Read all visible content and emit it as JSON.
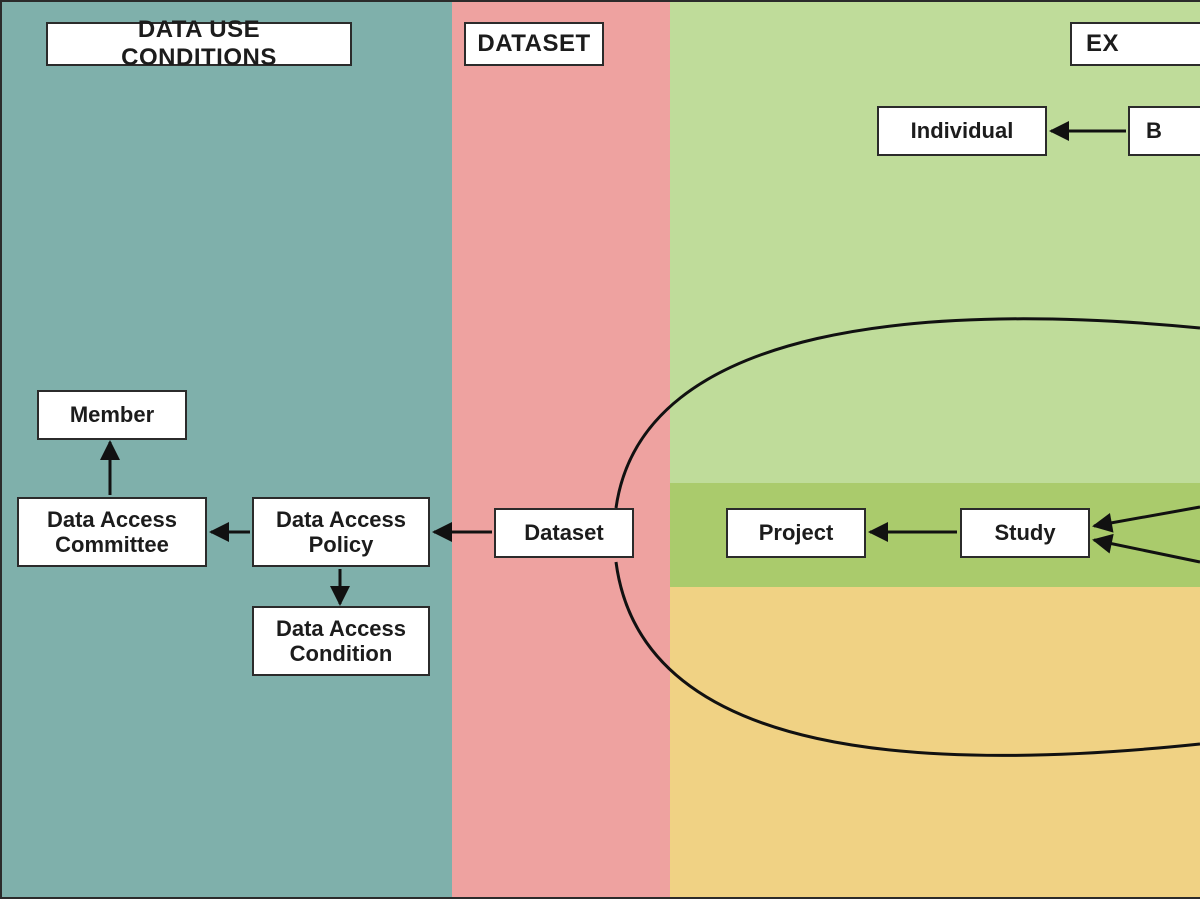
{
  "diagram": {
    "regions": {
      "data_use_conditions": {
        "label": "DATA USE CONDITIONS",
        "color": "#7fb0ab"
      },
      "dataset": {
        "label": "DATASET",
        "color": "#eea2a0"
      },
      "experiment_partial": {
        "label": "EX",
        "color_top": "#bfdc9a",
        "color_bottom": "#f0d284",
        "band": "#aacb6c"
      }
    },
    "nodes": {
      "member": {
        "label": "Member"
      },
      "data_access_committee": {
        "label": "Data Access Committee"
      },
      "data_access_policy": {
        "label": "Data Access Policy"
      },
      "data_access_condition": {
        "label": "Data Access Condition"
      },
      "dataset": {
        "label": "Dataset"
      },
      "project": {
        "label": "Project"
      },
      "study": {
        "label": "Study"
      },
      "individual": {
        "label": "Individual"
      },
      "b_partial": {
        "label": "B"
      }
    },
    "edges": [
      {
        "from": "data_access_committee",
        "to": "member"
      },
      {
        "from": "data_access_policy",
        "to": "data_access_committee"
      },
      {
        "from": "dataset",
        "to": "data_access_policy"
      },
      {
        "from": "data_access_policy",
        "to": "data_access_condition"
      },
      {
        "from": "study",
        "to": "project"
      },
      {
        "from": "b_partial",
        "to": "individual"
      },
      {
        "from": "offscreen_right",
        "to": "study"
      },
      {
        "from": "dataset_curve_top",
        "to": "offscreen_right_top"
      },
      {
        "from": "dataset_curve_bottom",
        "to": "offscreen_right_bottom"
      }
    ]
  }
}
